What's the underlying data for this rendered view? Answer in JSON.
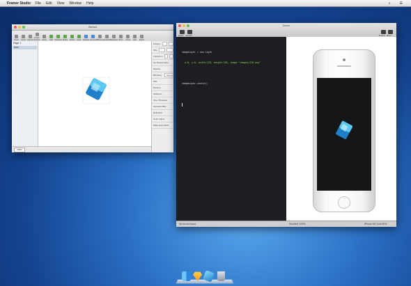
{
  "menubar": {
    "apple": "",
    "app": "Framer Studio",
    "items": [
      "File",
      "Edit",
      "View",
      "Window",
      "Help"
    ],
    "right_items": [
      "⌕",
      "☰"
    ]
  },
  "sketch_window": {
    "title": "Sketch",
    "toolbar": [
      "Insert",
      "Group",
      "Ungroup",
      "Create Symbol",
      "Zoom",
      "Edit",
      "Transform",
      "Rotate",
      "Flatten",
      "Union",
      "Subtract",
      "Intersect",
      "Difference",
      "Forward",
      "Backward",
      "Mirror",
      "Cloud",
      "View",
      "Export"
    ],
    "pages_header": "Page 1",
    "layer_name": "Icon",
    "inspector": {
      "rows": [
        "Position",
        "Size",
        "Transform",
        "No Shared Style",
        "Opacity",
        "Blending",
        "Fills",
        "Borders",
        "Shadows",
        "Inner Shadows",
        "Gaussian Blur",
        "Reflection",
        "Color Adjust",
        "Make Exportable"
      ],
      "blending_value": "Normal",
      "fill_labels": [
        "Fill",
        "Blending",
        "Opacity"
      ],
      "border_labels": [
        "Color",
        "Position",
        "Thickness"
      ]
    },
    "zoom_value": "100%"
  },
  "framer_window": {
    "title": "Demo",
    "toolbar_left": [
      "Sketch",
      "Devices"
    ],
    "toolbar_right": [
      "Present",
      "Mirror"
    ],
    "code_lines": [
      [
        "imageLayer = new Layer"
      ],
      [
        "  x:0, y:0, width:128, height:128, image:\"images/128.png\""
      ],
      [
        ""
      ],
      [
        "imageLayer.center()"
      ],
      [
        ""
      ],
      [
        ""
      ]
    ],
    "editor_status": "No errors found",
    "preview_status_left": "Scrolled: 100%",
    "preview_status_right": "iPhone 5S Gold  50%"
  },
  "dock": {
    "items": [
      "finder-icon",
      "sketch-icon",
      "framer-icon",
      "trash-icon"
    ]
  },
  "colors": {
    "accent": "#2aa8e8",
    "desktop": "#2a6fc4"
  }
}
